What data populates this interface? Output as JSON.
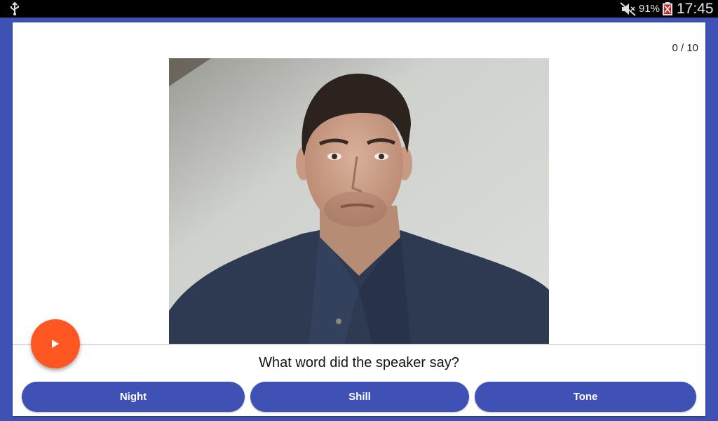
{
  "status_bar": {
    "battery_percent": "91%",
    "time": "17:45",
    "icons": [
      "usb-icon",
      "mute-icon",
      "battery-icon"
    ]
  },
  "quiz": {
    "progress": "0 / 10",
    "question": "What word did the speaker say?",
    "answers": [
      "Night",
      "Shill",
      "Tone"
    ],
    "play_icon": "play-icon"
  },
  "colors": {
    "primary": "#3f51b5",
    "accent": "#ff5722",
    "status_bar": "#000000",
    "card": "#ffffff"
  }
}
